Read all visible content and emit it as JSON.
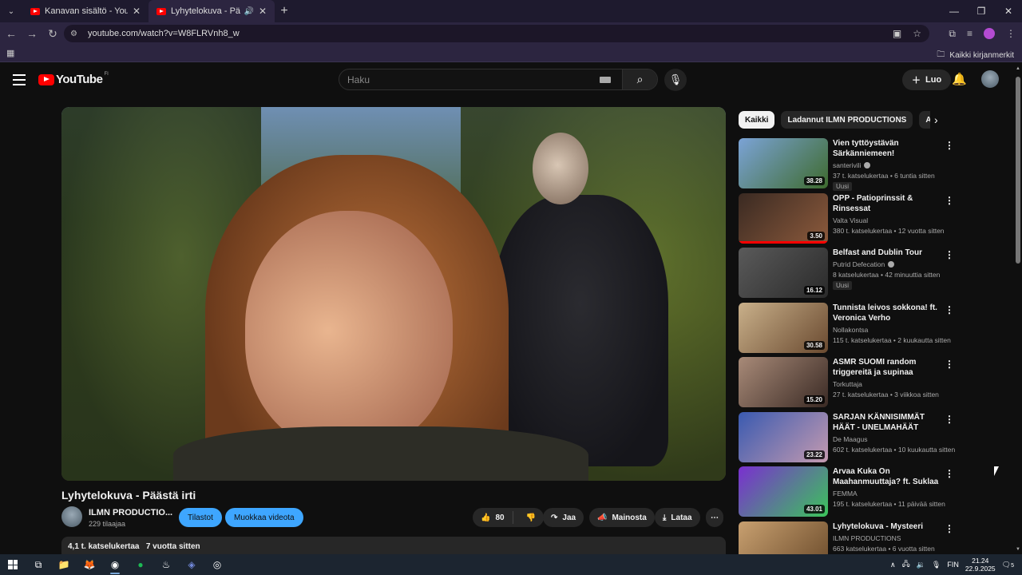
{
  "browser": {
    "tabs": [
      {
        "label": "Kanavan sisältö - YouTube Studio",
        "active": false
      },
      {
        "label": "Lyhytelokuva - Päästä irti - YouTube",
        "active": true
      }
    ],
    "url": "youtube.com/watch?v=W8FLRVnh8_w",
    "bookmarks_label": "Kaikki kirjanmerkit"
  },
  "header": {
    "logo_text": "YouTube",
    "country_code": "FI",
    "search_placeholder": "Haku",
    "create_label": "Luo"
  },
  "video": {
    "title": "Lyhytelokuva - Päästä irti",
    "channel": "ILMN PRODUCTIO...",
    "subscribers": "229 tilaajaa",
    "stats_button": "Tilastot",
    "edit_button": "Muokkaa videota",
    "likes": "80",
    "share_label": "Jaa",
    "promote_label": "Mainosta",
    "download_label": "Lataa",
    "views": "4,1 t. katselukertaa",
    "age": "7 vuotta sitten"
  },
  "chips": [
    "Kaikki",
    "Ladannut ILMN PRODUCTIONS",
    "Aiheeseen liittyvät"
  ],
  "recommendations": [
    {
      "title": "Vien tyttöystävän Särkänniemeen!",
      "channel": "santerivili",
      "verified": true,
      "meta": "37 t. katselukertaa • 6 tuntia sitten",
      "badge": "Uusi",
      "duration": "38.28",
      "colors": [
        "#7ba3d6",
        "#3e6b2e"
      ],
      "progress": 0
    },
    {
      "title": "OPP - Patioprinssit & Rinsessat",
      "channel": "Valta Visual",
      "verified": false,
      "meta": "380 t. katselukertaa • 12 vuotta sitten",
      "badge": "",
      "duration": "3.50",
      "colors": [
        "#3a2a22",
        "#8c5a3c"
      ],
      "progress": 1.0
    },
    {
      "title": "Belfast and Dublin Tour",
      "channel": "Putrid Defecation",
      "verified": true,
      "meta": "8 katselukertaa • 42 minuuttia sitten",
      "badge": "Uusi",
      "duration": "16.12",
      "colors": [
        "#5a5a5a",
        "#2a2a2a"
      ],
      "progress": 0
    },
    {
      "title": "Tunnista leivos sokkona! ft. Veronica Verho",
      "channel": "Nollakontsa",
      "verified": false,
      "meta": "115 t. katselukertaa • 2 kuukautta sitten",
      "badge": "",
      "duration": "30.58",
      "colors": [
        "#c9b08a",
        "#6a4a30"
      ],
      "progress": 0
    },
    {
      "title": "ASMR SUOMI random triggereitä ja supinaa shhhhh",
      "channel": "Torkuttaja",
      "verified": false,
      "meta": "27 t. katselukertaa • 3 viikkoa sitten",
      "badge": "",
      "duration": "15.20",
      "colors": [
        "#a88a78",
        "#3a2a24"
      ],
      "progress": 0
    },
    {
      "title": "SARJAN KÄNNISIMMÄT HÄÄT - UNELMAHÄÄT",
      "channel": "De Maagus",
      "verified": false,
      "meta": "602 t. katselukertaa • 10 kuukautta sitten",
      "badge": "",
      "duration": "23.22",
      "colors": [
        "#3a5ab0",
        "#c49ab0"
      ],
      "progress": 0
    },
    {
      "title": "Arvaa Kuka On Maahanmuuttaja? ft. Suklaa",
      "channel": "FEMMA",
      "verified": false,
      "meta": "195 t. katselukertaa • 11 päivää sitten",
      "badge": "",
      "duration": "43.01",
      "colors": [
        "#7a2fd0",
        "#3bc45a"
      ],
      "progress": 0
    },
    {
      "title": "Lyhytelokuva - Mysteeri",
      "channel": "ILMN PRODUCTIONS",
      "verified": false,
      "meta": "663 katselukertaa • 6 vuotta sitten",
      "badge": "",
      "duration": "",
      "colors": [
        "#c8a070",
        "#6a4a2a"
      ],
      "progress": 0
    }
  ],
  "taskbar": {
    "lang": "FIN",
    "time": "21.24",
    "date": "22.9.2025",
    "notifications": "5"
  }
}
